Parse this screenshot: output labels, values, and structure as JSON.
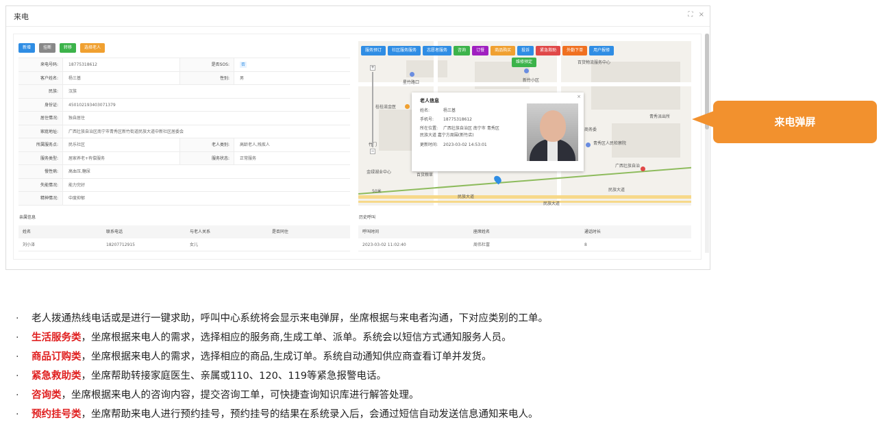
{
  "window": {
    "title": "来电",
    "controls": [
      "⛶",
      "×"
    ]
  },
  "actions": [
    {
      "label": "新增",
      "color": "#2f8de4"
    },
    {
      "label": "挂断",
      "color": "#888888"
    },
    {
      "label": "转移",
      "color": "#3cb34a"
    },
    {
      "label": "选择老人",
      "color": "#f0a030"
    }
  ],
  "form": {
    "phone_label": "来电号码:",
    "phone_value": "18775318612",
    "sos_label": "是否SOS:",
    "sos_value": "否",
    "name_label": "客户姓名:",
    "name_value": "杨三基",
    "gender_label": "性别:",
    "gender_value": "男",
    "ethnic_label": "民族:",
    "ethnic_value": "汉族",
    "id_label": "身份证:",
    "id_value": "450102193403071379",
    "living_label": "居住情况:",
    "living_value": "独自居住",
    "address_label": "家庭地址:",
    "address_value": "广西壮族自治区南宁市青秀区新竹街道民族大道中新社区居委会",
    "agency_label": "所属服务点:",
    "agency_value": "民乐社区",
    "elder_type_label": "老人类别:",
    "elder_type_value": "高龄老人,残疾人",
    "service_type_label": "服务类型:",
    "service_type_value": "居家养老+有偿服务",
    "service_status_label": "服务状态:",
    "service_status_value": "正常服务",
    "chronic_label": "慢性病:",
    "chronic_value": "高血压,糖尿",
    "ability_label": "失能情况:",
    "ability_value": "能力完好",
    "disease_label": "精神情况:",
    "disease_value": "中度抑郁"
  },
  "map_tools": [
    {
      "label": "服务预订",
      "color": "#2f8de4"
    },
    {
      "label": "社区服务服务",
      "color": "#2f8de4"
    },
    {
      "label": "志愿者服务",
      "color": "#2f8de4"
    },
    {
      "label": "咨询",
      "color": "#3cb34a"
    },
    {
      "label": "订餐",
      "color": "#a020c0"
    },
    {
      "label": "商品购买",
      "color": "#f0a030"
    },
    {
      "label": "投诉",
      "color": "#2f8de4"
    },
    {
      "label": "紧急救助",
      "color": "#e04848"
    },
    {
      "label": "外勤下单",
      "color": "#f07020"
    },
    {
      "label": "用户报修",
      "color": "#2f8de4"
    }
  ],
  "map_tool_extra": {
    "label": "维修预定",
    "color": "#3cb34a"
  },
  "map_labels": {
    "a": "民族大道",
    "b": "星竹路口",
    "c": "新竹小区",
    "d": "桂桂滋金医",
    "e": "邕宁区人民政府",
    "f": "广西壮族自治",
    "g": "金绿湖业中心",
    "h": "商务委",
    "i": "青秀区人民检察院",
    "j": "民族大道",
    "k": "民族大道",
    "l": "百货物流服务中心",
    "m": "青秀派出所",
    "n": "竹门",
    "o": "百货粮草",
    "p": "50米"
  },
  "popup": {
    "title": "老人信息",
    "name_k": "姓名:",
    "name_v": "杨三基",
    "phone_k": "手机号:",
    "phone_v": "18775318612",
    "loc_k": "所在位置:",
    "loc_v1": "广西壮族自治区 南宁市 青秀区",
    "loc_v2": "民族大道 嘉宁方周围(新竹店)",
    "time_k": "更新时间:",
    "time_v": "2023-03-02 14:53:01",
    "close": "×"
  },
  "callout": "来电弹屏",
  "family": {
    "title": "亲属信息",
    "headers": [
      "姓名",
      "联系电话",
      "与老人关系",
      "是否同住"
    ],
    "rows": [
      [
        "刘小泽",
        "18207712915",
        "女儿",
        ""
      ]
    ]
  },
  "history": {
    "title": "历史呼叫",
    "headers": [
      "呼叫时间",
      "座席姓名",
      "通话时长"
    ],
    "rows": [
      [
        "2023-03-02 11:02:40",
        "周伟杜富",
        "8"
      ]
    ]
  },
  "bullets": [
    {
      "hl": "",
      "text": "老人拨通热线电话或是进行一键求助，呼叫中心系统将会显示来电弹屏，坐席根据与来电者沟通，下对应类别的工单。"
    },
    {
      "hl": "生活服务类",
      "text": "，坐席根据来电人的需求，选择相应的服务商,生成工单、派单。系统会以短信方式通知服务人员。"
    },
    {
      "hl": "商品订购类",
      "text": "，坐席根据来电人的需求，选择相应的商品,生成订单。系统自动通知供应商查看订单并发货。"
    },
    {
      "hl": "紧急救助类",
      "text": "，坐席帮助转接家庭医生、亲属或110、120、119等紧急报警电话。"
    },
    {
      "hl": "咨询类",
      "text": "，坐席根据来电人的咨询内容，提交咨询工单，可快捷查询知识库进行解答处理。"
    },
    {
      "hl": "预约挂号类",
      "text": "，坐席帮助来电人进行预约挂号，预约挂号的结果在系统录入后，会通过短信自动发送信息通知来电人。"
    }
  ],
  "bullet_dot": "·"
}
